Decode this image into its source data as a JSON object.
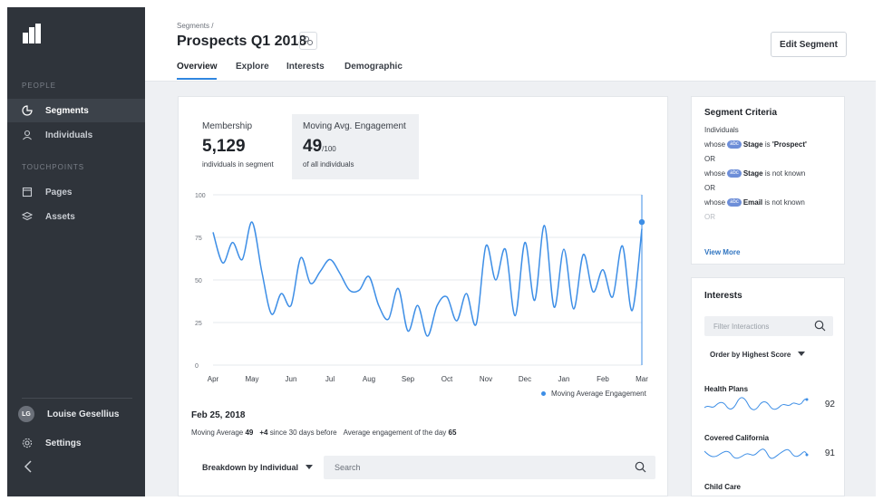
{
  "sidebar": {
    "section_people": "PEOPLE",
    "section_touchpoints": "TOUCHPOINTS",
    "items": [
      {
        "label": "Segments",
        "icon": "segments-icon",
        "active": true
      },
      {
        "label": "Individuals",
        "icon": "person-icon",
        "active": false
      },
      {
        "label": "Pages",
        "icon": "page-icon",
        "active": false
      },
      {
        "label": "Assets",
        "icon": "assets-icon",
        "active": false
      }
    ],
    "user": {
      "initials": "LG",
      "name": "Louise Gesellius"
    },
    "settings_label": "Settings"
  },
  "header": {
    "breadcrumb": "Segments /",
    "title": "Prospects Q1 2018",
    "edit_button": "Edit Segment",
    "tabs": [
      "Overview",
      "Explore",
      "Interests",
      "Demographic"
    ],
    "active_tab": "Overview"
  },
  "stats": {
    "membership": {
      "label": "Membership",
      "value": "5,129",
      "sub": "individuals in segment"
    },
    "engagement": {
      "label": "Moving Avg. Engagement",
      "value": "49",
      "suffix": "/100",
      "sub": "of all individuals"
    }
  },
  "chart_data": {
    "type": "line",
    "title": "",
    "xlabel": "",
    "ylabel": "",
    "ylim": [
      0,
      100
    ],
    "yticks": [
      0,
      25,
      50,
      75,
      100
    ],
    "x_tick_labels": [
      "Apr",
      "May",
      "Jun",
      "Jul",
      "Aug",
      "Sep",
      "Oct",
      "Nov",
      "Dec",
      "Jan",
      "Feb",
      "Mar"
    ],
    "series": [
      {
        "name": "Moving Average Engagement",
        "color": "#3d8ee6",
        "values": [
          78,
          60,
          72,
          62,
          84,
          55,
          30,
          42,
          35,
          63,
          48,
          55,
          62,
          54,
          44,
          44,
          52,
          35,
          27,
          45,
          20,
          35,
          17,
          35,
          40,
          26,
          42,
          24,
          70,
          50,
          68,
          29,
          72,
          38,
          82,
          34,
          68,
          33,
          65,
          43,
          56,
          40,
          70,
          32,
          80
        ]
      }
    ],
    "highlight": {
      "value": 84,
      "date": "Feb 25, 2018"
    },
    "grid": true,
    "legend": "bottom-right"
  },
  "selection": {
    "date": "Feb 25, 2018",
    "moving_average_label": "Moving Average",
    "moving_average_value": "49",
    "delta": "+4",
    "delta_label": "since 30 days before",
    "day_label": "Average engagement of the day",
    "day_value": "65"
  },
  "breakdown": {
    "label": "Breakdown by Individual",
    "search_placeholder": "Search"
  },
  "criteria": {
    "title": "Segment Criteria",
    "subject": "Individuals",
    "rules": [
      {
        "prefix": "whose",
        "badge": "abc",
        "field": "Stage",
        "op": "is",
        "value": "'Prospect'"
      },
      {
        "prefix": "whose",
        "badge": "abc",
        "field": "Stage",
        "op": "is not known",
        "value": ""
      },
      {
        "prefix": "whose",
        "badge": "abc",
        "field": "Email",
        "op": "is not known",
        "value": ""
      }
    ],
    "joiner": "OR",
    "view_more": "View More"
  },
  "interests": {
    "title": "Interests",
    "filter_placeholder": "Filter Interactions",
    "order_by": "Order by Highest Score",
    "items": [
      {
        "name": "Health Plans",
        "score": "92"
      },
      {
        "name": "Covered California",
        "score": "91"
      },
      {
        "name": "Child Care",
        "score": ""
      }
    ]
  }
}
